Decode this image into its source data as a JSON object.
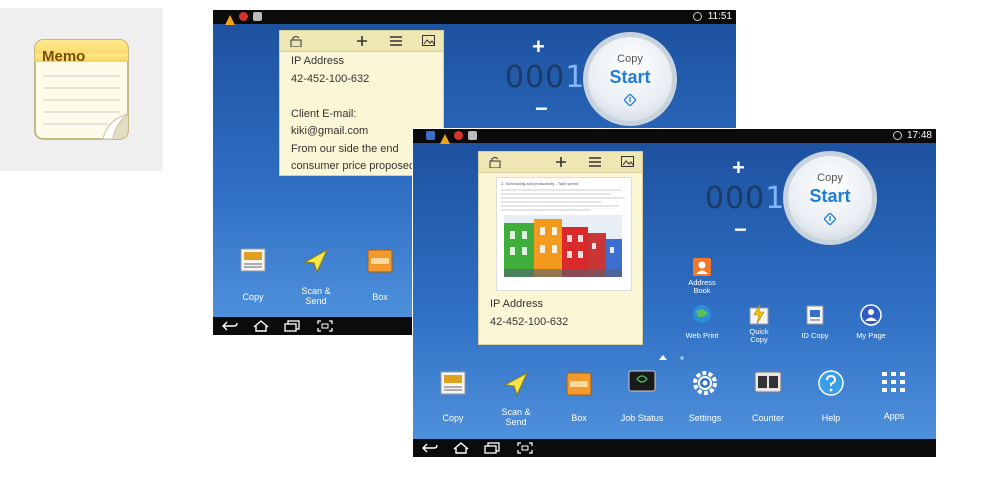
{
  "memo_tile": {
    "label": "Memo"
  },
  "screen_back": {
    "clock": "11:51",
    "note": {
      "lines": [
        "IP Address",
        "42-452-100-632",
        "",
        "Client E-mail:",
        "kiki@gmail.com",
        "From our side the end",
        "consumer price proposed"
      ]
    },
    "counter": {
      "digits": "000",
      "last_digit": "1"
    },
    "start": {
      "copy": "Copy",
      "start": "Start"
    },
    "apps": [
      {
        "label_l1": "Copy",
        "label_l2": ""
      },
      {
        "label_l1": "Scan &",
        "label_l2": "Send"
      },
      {
        "label_l1": "Box",
        "label_l2": ""
      }
    ]
  },
  "screen_front": {
    "clock": "17:48",
    "note": {
      "doc_heading": "2. Scheduling and productivity - Take speed",
      "lines": [
        "IP Address",
        "42-452-100-632"
      ]
    },
    "counter": {
      "digits": "000",
      "last_digit": "1"
    },
    "start": {
      "copy": "Copy",
      "start": "Start"
    },
    "small_apps": [
      {
        "label_l1": "Address",
        "label_l2": "Book"
      },
      {
        "label_l1": "Web Print",
        "label_l2": ""
      },
      {
        "label_l1": "Quick",
        "label_l2": "Copy"
      },
      {
        "label_l1": "ID Copy",
        "label_l2": ""
      },
      {
        "label_l1": "My Page",
        "label_l2": ""
      }
    ],
    "apps": [
      {
        "label_l1": "Copy",
        "label_l2": ""
      },
      {
        "label_l1": "Scan &",
        "label_l2": "Send"
      },
      {
        "label_l1": "Box",
        "label_l2": ""
      },
      {
        "label_l1": "Job Status",
        "label_l2": ""
      },
      {
        "label_l1": "Settings",
        "label_l2": ""
      },
      {
        "label_l1": "Counter",
        "label_l2": ""
      },
      {
        "label_l1": "Help",
        "label_l2": ""
      },
      {
        "label_l1": "Apps",
        "label_l2": ""
      }
    ]
  },
  "colors": {
    "accent": "#1e7ed8",
    "screen_top": "#1c4f9c",
    "screen_bottom": "#5295de",
    "note_bg": "#fbf7d6"
  }
}
